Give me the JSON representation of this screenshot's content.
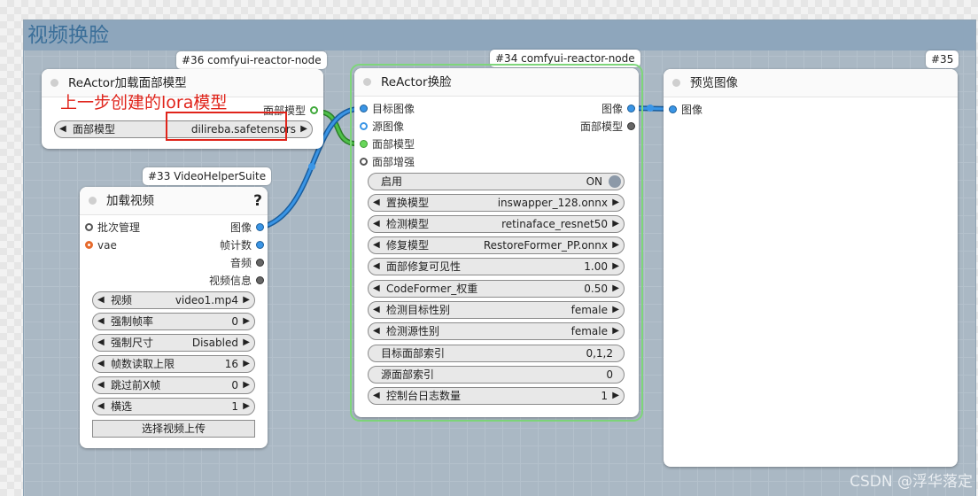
{
  "group": {
    "title": "视频换脸"
  },
  "node36": {
    "badge": "#36 comfyui-reactor-node",
    "title": "ReActor加载面部模型",
    "output": "面部模型",
    "widget_label": "面部模型",
    "widget_value": "dilireba.safetensors"
  },
  "annotation": {
    "text": "上一步创建的lora模型"
  },
  "node33": {
    "badge": "#33 VideoHelperSuite",
    "title": "加载视频",
    "help": "?",
    "inputs": [
      "批次管理",
      "vae"
    ],
    "outputs": [
      "图像",
      "帧计数",
      "音频",
      "视频信息"
    ],
    "widgets": [
      {
        "label": "视频",
        "value": "video1.mp4"
      },
      {
        "label": "强制帧率",
        "value": "0"
      },
      {
        "label": "强制尺寸",
        "value": "Disabled"
      },
      {
        "label": "帧数读取上限",
        "value": "16"
      },
      {
        "label": "跳过前X帧",
        "value": "0"
      },
      {
        "label": "横选",
        "value": "1"
      }
    ],
    "upload_button": "选择视频上传"
  },
  "node34": {
    "badge": "#34 comfyui-reactor-node",
    "title": "ReActor换脸",
    "inputs": [
      "目标图像",
      "源图像",
      "面部模型",
      "面部增强"
    ],
    "outputs": [
      "图像",
      "面部模型"
    ],
    "toggle": {
      "label": "启用",
      "value": "ON"
    },
    "widgets": [
      {
        "label": "置换模型",
        "value": "inswapper_128.onnx"
      },
      {
        "label": "检测模型",
        "value": "retinaface_resnet50"
      },
      {
        "label": "修复模型",
        "value": "RestoreFormer_PP.onnx"
      },
      {
        "label": "面部修复可见性",
        "value": "1.00"
      },
      {
        "label": "CodeFormer_权重",
        "value": "0.50"
      },
      {
        "label": "检测目标性别",
        "value": "female"
      },
      {
        "label": "检测源性别",
        "value": "female"
      }
    ],
    "text_widgets": [
      {
        "label": "目标面部索引",
        "value": "0,1,2"
      },
      {
        "label": "源面部索引",
        "value": "0"
      }
    ],
    "last_widget": {
      "label": "控制台日志数量",
      "value": "1"
    }
  },
  "node35": {
    "badge": "#35",
    "title": "预览图像",
    "input": "图像"
  },
  "watermark": "CSDN @浮华落定",
  "colors": {
    "image_wire": "#3a95e6",
    "face_model_wire": "#3ea83a",
    "annotation": "#e0241b",
    "selection": "#7ed67a"
  }
}
